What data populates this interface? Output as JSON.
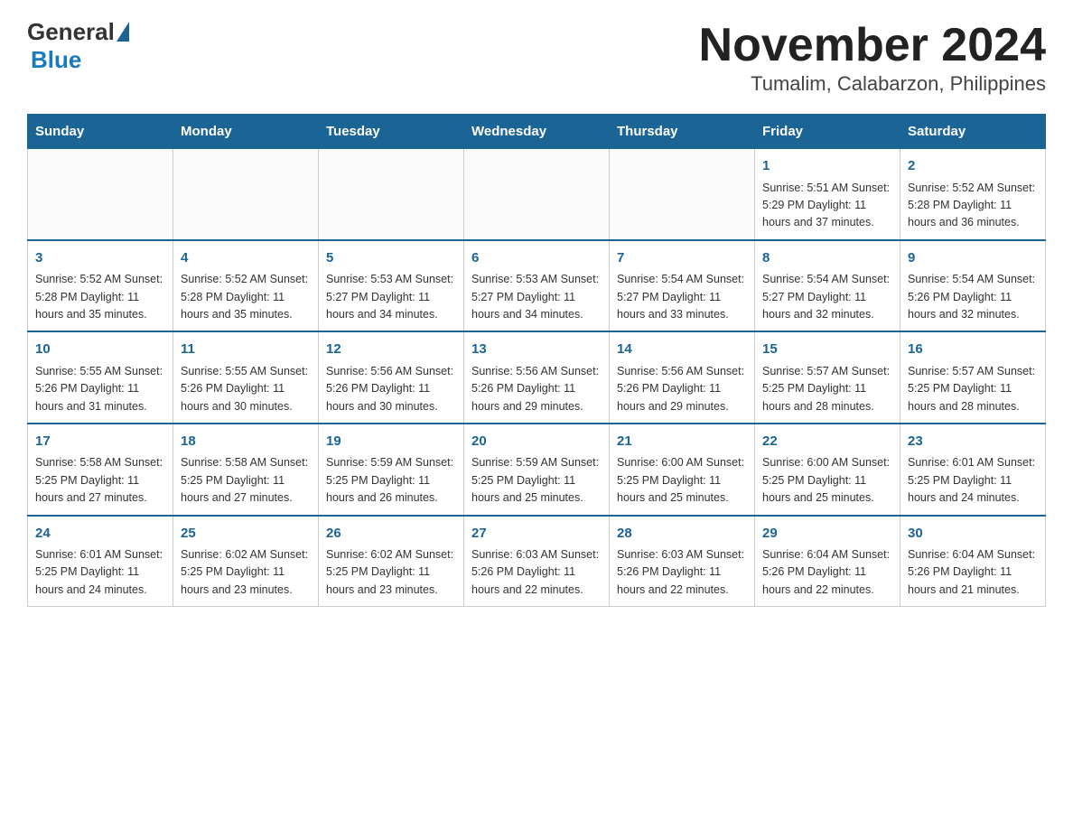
{
  "header": {
    "logo_general": "General",
    "logo_blue": "Blue",
    "title": "November 2024",
    "subtitle": "Tumalim, Calabarzon, Philippines"
  },
  "calendar": {
    "days_of_week": [
      "Sunday",
      "Monday",
      "Tuesday",
      "Wednesday",
      "Thursday",
      "Friday",
      "Saturday"
    ],
    "weeks": [
      [
        {
          "day": "",
          "info": ""
        },
        {
          "day": "",
          "info": ""
        },
        {
          "day": "",
          "info": ""
        },
        {
          "day": "",
          "info": ""
        },
        {
          "day": "",
          "info": ""
        },
        {
          "day": "1",
          "info": "Sunrise: 5:51 AM\nSunset: 5:29 PM\nDaylight: 11 hours and 37 minutes."
        },
        {
          "day": "2",
          "info": "Sunrise: 5:52 AM\nSunset: 5:28 PM\nDaylight: 11 hours and 36 minutes."
        }
      ],
      [
        {
          "day": "3",
          "info": "Sunrise: 5:52 AM\nSunset: 5:28 PM\nDaylight: 11 hours and 35 minutes."
        },
        {
          "day": "4",
          "info": "Sunrise: 5:52 AM\nSunset: 5:28 PM\nDaylight: 11 hours and 35 minutes."
        },
        {
          "day": "5",
          "info": "Sunrise: 5:53 AM\nSunset: 5:27 PM\nDaylight: 11 hours and 34 minutes."
        },
        {
          "day": "6",
          "info": "Sunrise: 5:53 AM\nSunset: 5:27 PM\nDaylight: 11 hours and 34 minutes."
        },
        {
          "day": "7",
          "info": "Sunrise: 5:54 AM\nSunset: 5:27 PM\nDaylight: 11 hours and 33 minutes."
        },
        {
          "day": "8",
          "info": "Sunrise: 5:54 AM\nSunset: 5:27 PM\nDaylight: 11 hours and 32 minutes."
        },
        {
          "day": "9",
          "info": "Sunrise: 5:54 AM\nSunset: 5:26 PM\nDaylight: 11 hours and 32 minutes."
        }
      ],
      [
        {
          "day": "10",
          "info": "Sunrise: 5:55 AM\nSunset: 5:26 PM\nDaylight: 11 hours and 31 minutes."
        },
        {
          "day": "11",
          "info": "Sunrise: 5:55 AM\nSunset: 5:26 PM\nDaylight: 11 hours and 30 minutes."
        },
        {
          "day": "12",
          "info": "Sunrise: 5:56 AM\nSunset: 5:26 PM\nDaylight: 11 hours and 30 minutes."
        },
        {
          "day": "13",
          "info": "Sunrise: 5:56 AM\nSunset: 5:26 PM\nDaylight: 11 hours and 29 minutes."
        },
        {
          "day": "14",
          "info": "Sunrise: 5:56 AM\nSunset: 5:26 PM\nDaylight: 11 hours and 29 minutes."
        },
        {
          "day": "15",
          "info": "Sunrise: 5:57 AM\nSunset: 5:25 PM\nDaylight: 11 hours and 28 minutes."
        },
        {
          "day": "16",
          "info": "Sunrise: 5:57 AM\nSunset: 5:25 PM\nDaylight: 11 hours and 28 minutes."
        }
      ],
      [
        {
          "day": "17",
          "info": "Sunrise: 5:58 AM\nSunset: 5:25 PM\nDaylight: 11 hours and 27 minutes."
        },
        {
          "day": "18",
          "info": "Sunrise: 5:58 AM\nSunset: 5:25 PM\nDaylight: 11 hours and 27 minutes."
        },
        {
          "day": "19",
          "info": "Sunrise: 5:59 AM\nSunset: 5:25 PM\nDaylight: 11 hours and 26 minutes."
        },
        {
          "day": "20",
          "info": "Sunrise: 5:59 AM\nSunset: 5:25 PM\nDaylight: 11 hours and 25 minutes."
        },
        {
          "day": "21",
          "info": "Sunrise: 6:00 AM\nSunset: 5:25 PM\nDaylight: 11 hours and 25 minutes."
        },
        {
          "day": "22",
          "info": "Sunrise: 6:00 AM\nSunset: 5:25 PM\nDaylight: 11 hours and 25 minutes."
        },
        {
          "day": "23",
          "info": "Sunrise: 6:01 AM\nSunset: 5:25 PM\nDaylight: 11 hours and 24 minutes."
        }
      ],
      [
        {
          "day": "24",
          "info": "Sunrise: 6:01 AM\nSunset: 5:25 PM\nDaylight: 11 hours and 24 minutes."
        },
        {
          "day": "25",
          "info": "Sunrise: 6:02 AM\nSunset: 5:25 PM\nDaylight: 11 hours and 23 minutes."
        },
        {
          "day": "26",
          "info": "Sunrise: 6:02 AM\nSunset: 5:25 PM\nDaylight: 11 hours and 23 minutes."
        },
        {
          "day": "27",
          "info": "Sunrise: 6:03 AM\nSunset: 5:26 PM\nDaylight: 11 hours and 22 minutes."
        },
        {
          "day": "28",
          "info": "Sunrise: 6:03 AM\nSunset: 5:26 PM\nDaylight: 11 hours and 22 minutes."
        },
        {
          "day": "29",
          "info": "Sunrise: 6:04 AM\nSunset: 5:26 PM\nDaylight: 11 hours and 22 minutes."
        },
        {
          "day": "30",
          "info": "Sunrise: 6:04 AM\nSunset: 5:26 PM\nDaylight: 11 hours and 21 minutes."
        }
      ]
    ]
  }
}
